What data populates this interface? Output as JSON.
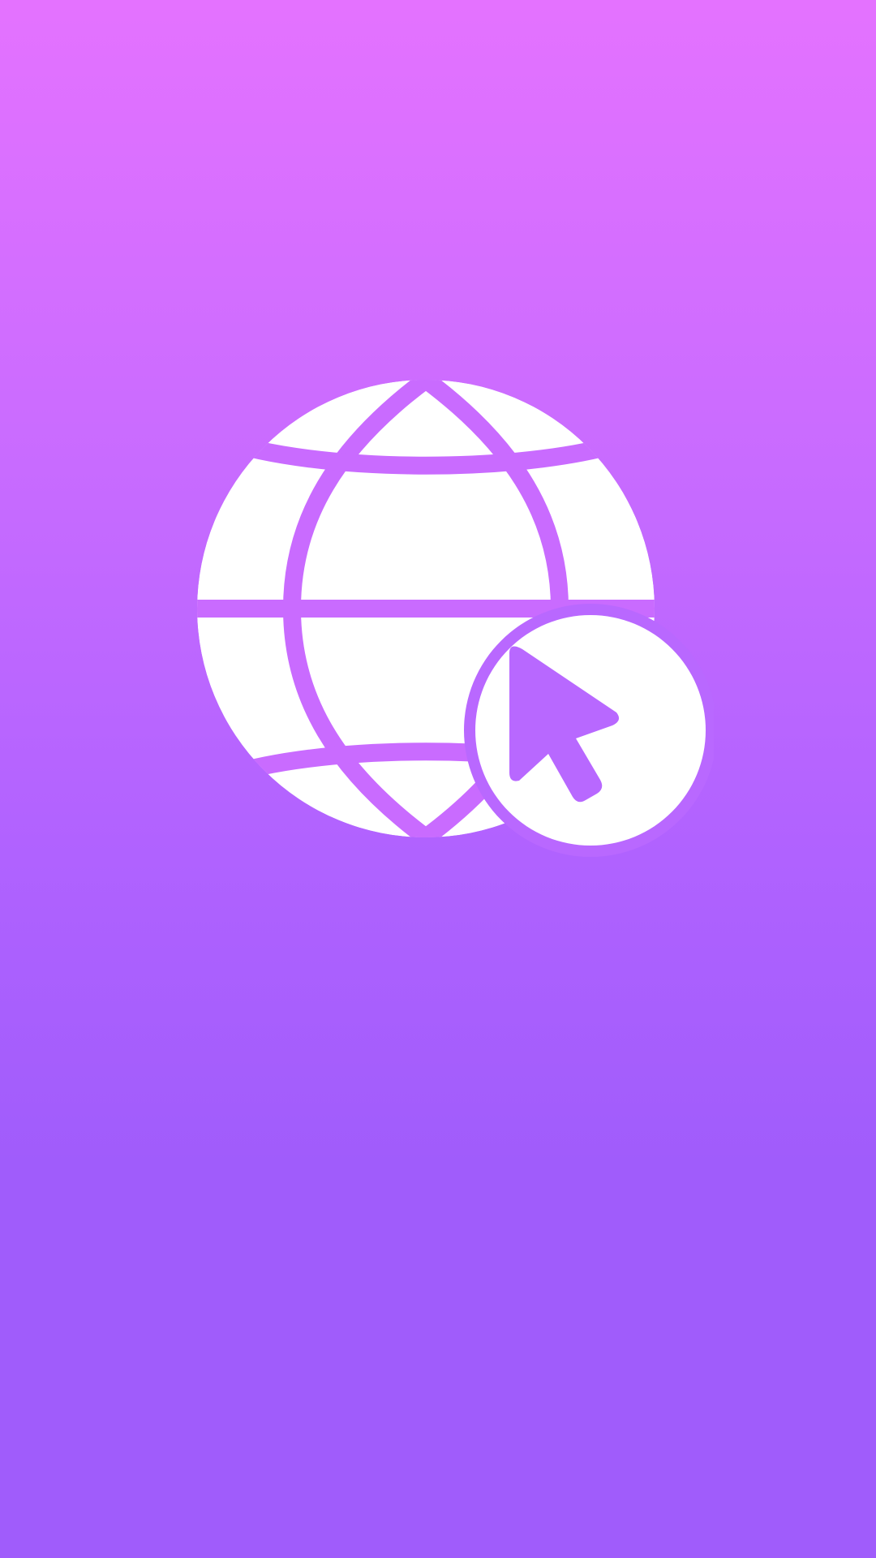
{
  "app": {
    "icon": "globe-cursor-icon"
  },
  "colors": {
    "background_top": "#e472ff",
    "background_mid": "#b062ff",
    "background_bottom": "#a05cfb",
    "icon_fill": "#ffffff"
  }
}
